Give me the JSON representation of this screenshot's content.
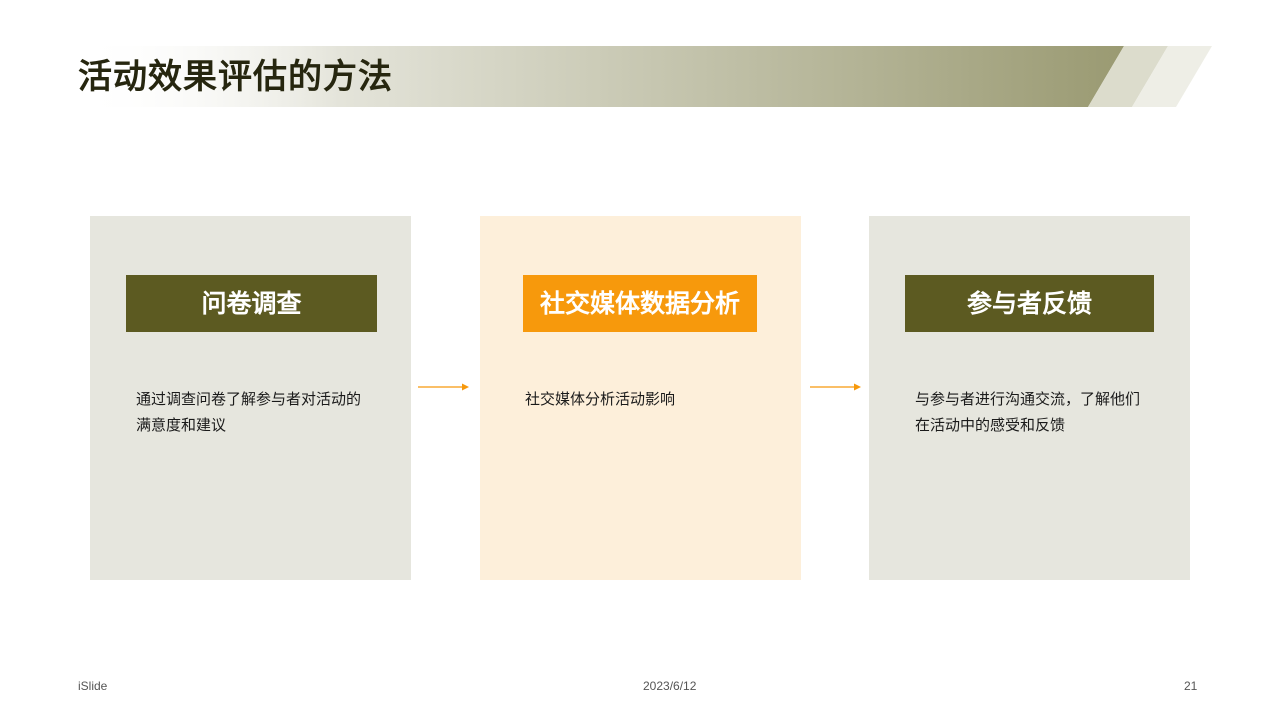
{
  "slide": {
    "title": "活动效果评估的方法",
    "colors": {
      "band_start": "#e4e4da",
      "band_end": "#9a9a72",
      "card_neutral": "#e6e6de",
      "card_accent": "#fdefda",
      "title_neutral": "#5c5a21",
      "title_accent": "#f7990c",
      "arrow": "#f7990c"
    }
  },
  "cards": [
    {
      "title": "问卷调查",
      "text_lines": [
        "通过调查问卷了解参与者对活动的",
        "满意度和建议"
      ]
    },
    {
      "title": "社交媒体数据分析",
      "text_lines": [
        "社交媒体分析活动影响"
      ]
    },
    {
      "title": "参与者反馈",
      "text_lines": [
        "与参与者进行沟通交流，了解他们",
        "在活动中的感受和反馈"
      ]
    }
  ],
  "footer": {
    "brand": "iSlide",
    "date": "2023/6/12",
    "page_number": "21"
  }
}
